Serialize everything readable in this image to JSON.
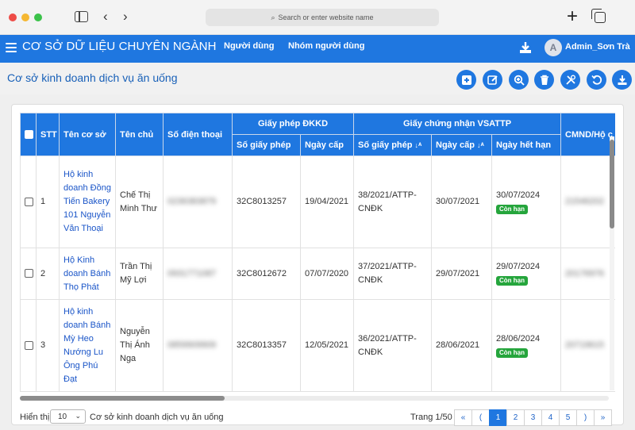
{
  "browser": {
    "url_placeholder": "Search or enter website name",
    "search_icon": "⌕",
    "back_icon": "‹",
    "forward_icon": "›",
    "new_tab_icon": "+"
  },
  "appnav": {
    "title": "CƠ SỞ DỮ LIỆU CHUYÊN NGÀNH",
    "links": [
      "Người dùng",
      "Nhóm người dùng"
    ],
    "avatar_letter": "A",
    "username": "Admin_Sơn Trà",
    "accent_color": "#1f77e0"
  },
  "page": {
    "title": "Cơ sở kinh doanh dịch vụ ăn uống",
    "toolbar_icons": [
      "add-icon",
      "edit-icon",
      "zoom-icon",
      "delete-icon",
      "tools-icon",
      "refresh-icon",
      "download-icon"
    ]
  },
  "table": {
    "headers": {
      "stt": "STT",
      "name": "Tên cơ sở",
      "owner": "Tên chủ",
      "phone": "Số điện thoại",
      "license_group": "Giấy phép ĐKKD",
      "license_no": "Số giấy phép",
      "license_date": "Ngày cấp",
      "vsattp_group": "Giấy chứng nhận VSATTP",
      "vsattp_no": "Số giấy phép",
      "vsattp_date": "Ngày cấp",
      "vsattp_expiry": "Ngày hết hạn",
      "id_card": "CMND/Hộ c"
    },
    "rows": [
      {
        "stt": "1",
        "name": "Hộ kinh doanh Đồng Tiến Bakery 101 Nguyễn Văn Thoại",
        "owner": "Chế Thị Minh Thư",
        "phone": "0236383879",
        "license_no": "32C8013257",
        "license_date": "19/04/2021",
        "vsattp_no": "38/2021/ATTP-CNĐK",
        "vsattp_date": "30/07/2021",
        "vsattp_expiry": "30/07/2024",
        "status": "Còn hạn",
        "id_card": "21546202"
      },
      {
        "stt": "2",
        "name": "Hộ Kinh doanh Bánh Thọ Phát",
        "owner": "Trần Thị Mỹ Lợi",
        "phone": "0931771087",
        "license_no": "32C8012672",
        "license_date": "07/07/2020",
        "vsattp_no": "37/2021/ATTP-CNĐK",
        "vsattp_date": "29/07/2021",
        "vsattp_expiry": "29/07/2024",
        "status": "Còn hạn",
        "id_card": "20176976"
      },
      {
        "stt": "3",
        "name": "Hộ kinh doanh Bánh Mỳ Heo Nướng Lu Ông Phú Đạt",
        "owner": "Nguyễn Thị Ánh Nga",
        "phone": "0859909909",
        "license_no": "32C8013357",
        "license_date": "12/05/2021",
        "vsattp_no": "36/2021/ATTP-CNĐK",
        "vsattp_date": "28/06/2021",
        "vsattp_expiry": "28/06/2024",
        "status": "Còn hạn",
        "id_card": "20719615"
      }
    ],
    "status_color": "#25a53c"
  },
  "footer": {
    "show_label": "Hiển thị",
    "page_size": "10",
    "label": "Cơ sở kinh doanh dịch vụ ăn uống",
    "page_info": "Trang 1/50",
    "pager": [
      "«",
      "(",
      "1",
      "2",
      "3",
      "4",
      "5",
      ")",
      "»"
    ],
    "current_page": "1"
  }
}
